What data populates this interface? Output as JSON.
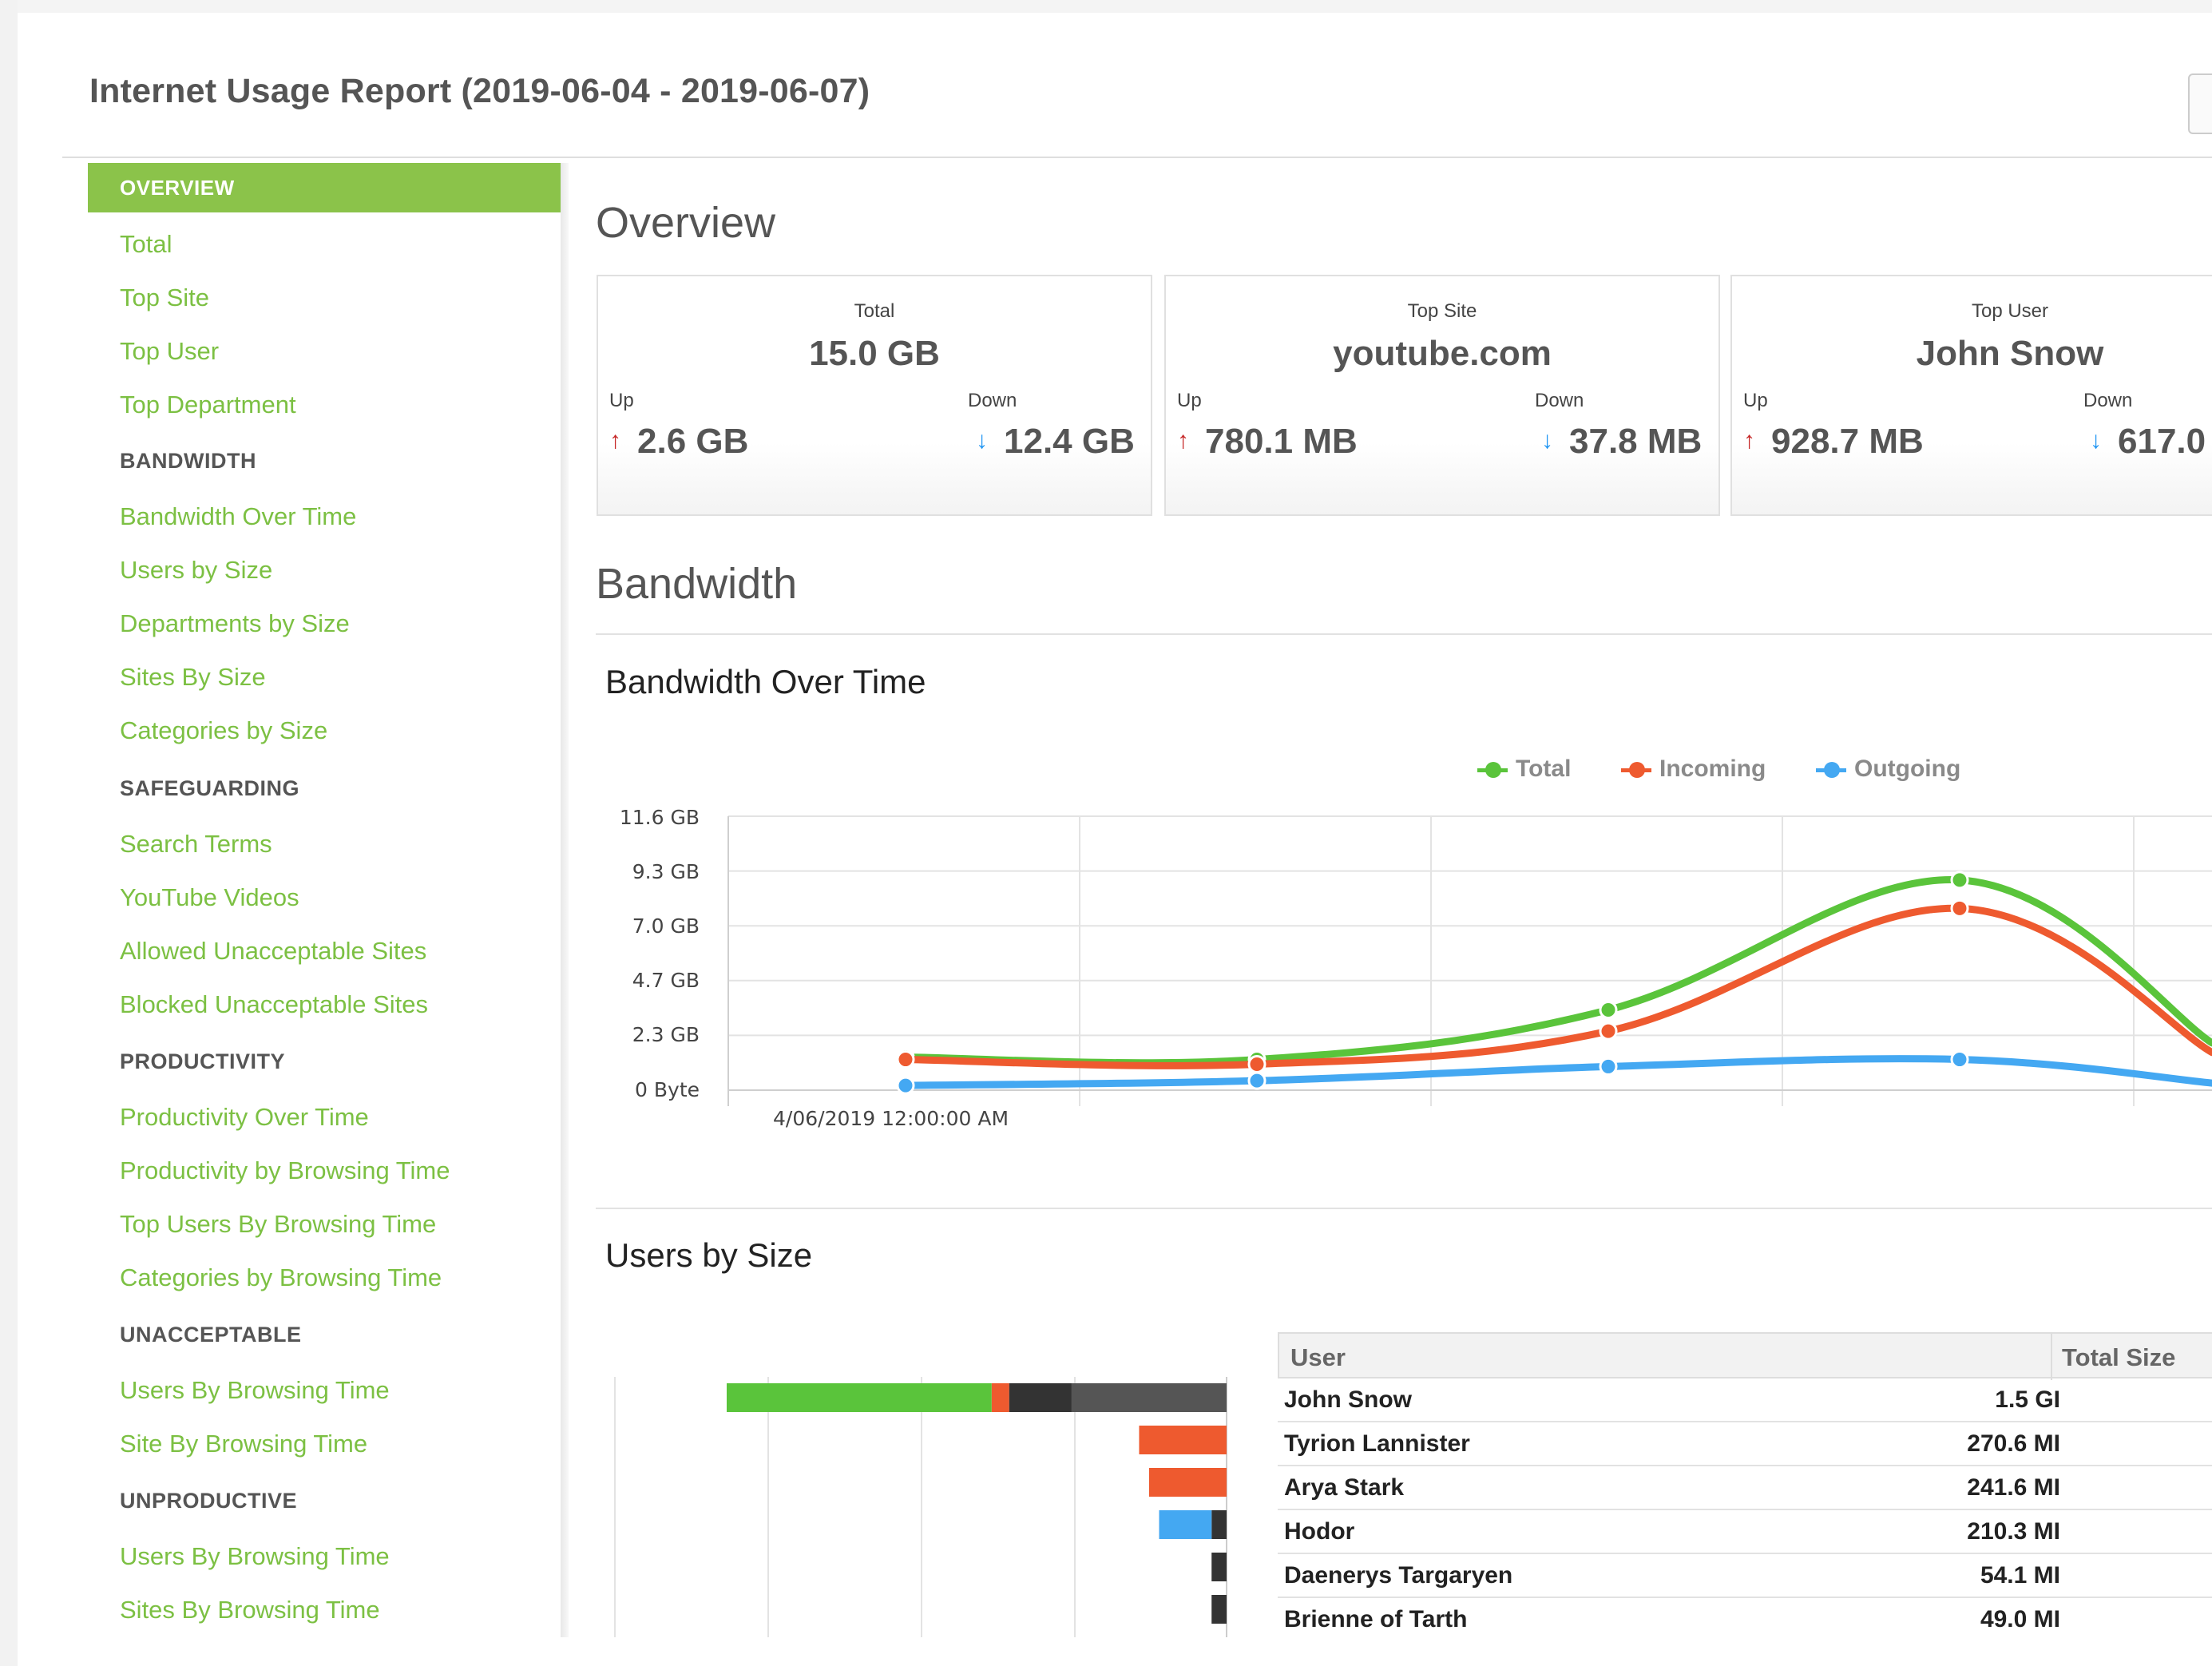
{
  "report_title": "Internet Usage Report (2019-06-04 - 2019-06-07)",
  "sidebar": {
    "active": "OVERVIEW",
    "overview_links": [
      "Total",
      "Top Site",
      "Top User",
      "Top Department"
    ],
    "bandwidth_heading": "BANDWIDTH",
    "bandwidth_links": [
      "Bandwidth Over Time",
      "Users by Size",
      "Departments by Size",
      "Sites By Size",
      "Categories by Size"
    ],
    "safeguarding_heading": "SAFEGUARDING",
    "safeguarding_links": [
      "Search Terms",
      "YouTube Videos",
      "Allowed Unacceptable Sites",
      "Blocked Unacceptable Sites"
    ],
    "productivity_heading": "PRODUCTIVITY",
    "productivity_links": [
      "Productivity Over Time",
      "Productivity by Browsing Time",
      "Top Users By Browsing Time",
      "Categories by Browsing Time"
    ],
    "unacceptable_heading": "UNACCEPTABLE",
    "unacceptable_links": [
      "Users By Browsing Time",
      "Site By Browsing Time"
    ],
    "unproductive_heading": "UNPRODUCTIVE",
    "unproductive_links": [
      "Users By Browsing Time",
      "Sites By Browsing Time"
    ]
  },
  "overview": {
    "heading": "Overview",
    "cards": [
      {
        "label": "Total",
        "value": "15.0 GB",
        "up_label": "Up",
        "up": "2.6 GB",
        "down_label": "Down",
        "down": "12.4 GB"
      },
      {
        "label": "Top Site",
        "value": "youtube.com",
        "up_label": "Up",
        "up": "780.1 MB",
        "down_label": "Down",
        "down": "37.8 MB"
      },
      {
        "label": "Top User",
        "value": "John Snow",
        "up_label": "Up",
        "up": "928.7 MB",
        "down_label": "Down",
        "down": "617.0"
      }
    ]
  },
  "bandwidth": {
    "heading": "Bandwidth",
    "over_time_title": "Bandwidth Over Time",
    "users_by_size_title": "Users by Size"
  },
  "chart_data": [
    {
      "type": "line",
      "title": "Bandwidth Over Time",
      "y_ticks": [
        "11.6 GB",
        "9.3 GB",
        "7.0 GB",
        "4.7 GB",
        "2.3 GB",
        "0 Byte"
      ],
      "ylim": [
        0,
        11.6
      ],
      "x_tick_labels": [
        "4/06/2019 12:00:00 AM"
      ],
      "x": [
        1,
        2,
        3,
        4,
        5
      ],
      "series": [
        {
          "name": "Total",
          "color": "#5ac43b",
          "values": [
            1.4,
            1.3,
            3.4,
            8.9,
            2.0
          ]
        },
        {
          "name": "Incoming",
          "color": "#ee5a2f",
          "values": [
            1.3,
            1.1,
            2.5,
            7.7,
            1.6
          ]
        },
        {
          "name": "Outgoing",
          "color": "#44a8f2",
          "values": [
            0.2,
            0.4,
            1.0,
            1.3,
            0.3
          ]
        }
      ],
      "legend_position": "top-right",
      "grid": true
    },
    {
      "type": "bar",
      "title": "Users by Size",
      "orientation": "horizontal",
      "stack_colors": [
        "#5ac43b",
        "#ee5a2f",
        "#44a8f2",
        "#333333",
        "#555555"
      ],
      "rows": [
        [
          0.53,
          0.035,
          0,
          0.125,
          0.31
        ],
        [
          0,
          0.175,
          0,
          0,
          0
        ],
        [
          0,
          0.155,
          0,
          0,
          0
        ],
        [
          0,
          0,
          0.105,
          0.03,
          0
        ],
        [
          0,
          0,
          0,
          0.03,
          0
        ],
        [
          0,
          0,
          0,
          0.03,
          0
        ]
      ]
    }
  ],
  "users_table": {
    "headers": [
      "User",
      "Total Size"
    ],
    "rows": [
      {
        "name": "John Snow",
        "size": "1.5 GI"
      },
      {
        "name": "Tyrion Lannister",
        "size": "270.6 MI"
      },
      {
        "name": "Arya Stark",
        "size": "241.6 MI"
      },
      {
        "name": "Hodor",
        "size": "210.3 MI"
      },
      {
        "name": "Daenerys Targaryen",
        "size": "54.1 MI"
      },
      {
        "name": "Brienne of Tarth",
        "size": "49.0 MI"
      }
    ]
  }
}
